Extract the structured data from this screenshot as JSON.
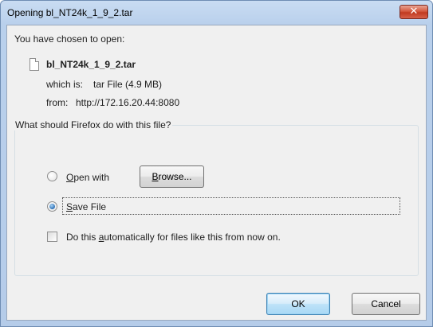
{
  "window": {
    "title": "Opening bl_NT24k_1_9_2.tar",
    "close_glyph": "✕"
  },
  "file": {
    "intro": "You have chosen to open:",
    "name": "bl_NT24k_1_9_2.tar",
    "which_is_label": "which is:",
    "which_is_value": "tar File (4.9 MB)",
    "from_label": "from:",
    "from_value": "http://172.16.20.44:8080",
    "icon": "file-icon"
  },
  "action_group": {
    "legend": "What should Firefox do with this file?",
    "open_with": {
      "mnemonic": "O",
      "rest": "pen with",
      "selected": false
    },
    "browse_button": {
      "mnemonic": "B",
      "rest": "rowse..."
    },
    "save_file": {
      "mnemonic": "S",
      "rest": "ave File",
      "selected": true
    },
    "auto_checkbox": {
      "before": "Do this ",
      "mnemonic": "a",
      "after": "utomatically for files like this from now on.",
      "checked": false
    }
  },
  "buttons": {
    "ok": "OK",
    "cancel": "Cancel"
  },
  "colors": {
    "titlebar": "#b9d0ec",
    "client_bg": "#f0f0f0",
    "close_button": "#c13a20",
    "default_button": "#a9d8f5"
  }
}
